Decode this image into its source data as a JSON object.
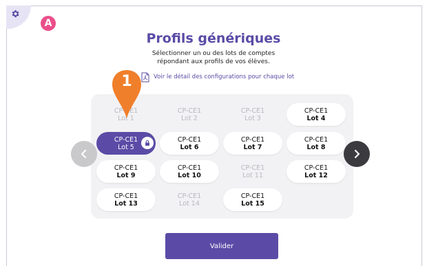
{
  "badge": "A",
  "title": "Profils génériques",
  "subtitle": [
    "Sélectionner un ou des lots de comptes",
    "répondant aux profils de vos élèves."
  ],
  "detail_link": "Voir le détail des configurations pour chaque lot",
  "marker_number": "1",
  "lots": [
    {
      "line1": "CP-CE1",
      "line2": "Lot 1",
      "state": "disabled"
    },
    {
      "line1": "CP-CE1",
      "line2": "Lot 2",
      "state": "disabled"
    },
    {
      "line1": "CP-CE1",
      "line2": "Lot 3",
      "state": "disabled"
    },
    {
      "line1": "CP-CE1",
      "line2": "Lot 4",
      "state": "available"
    },
    {
      "line1": "CP-CE1",
      "line2": "Lot 5",
      "state": "selected"
    },
    {
      "line1": "CP-CE1",
      "line2": "Lot 6",
      "state": "available"
    },
    {
      "line1": "CP-CE1",
      "line2": "Lot 7",
      "state": "available"
    },
    {
      "line1": "CP-CE1",
      "line2": "Lot 8",
      "state": "available"
    },
    {
      "line1": "CP-CE1",
      "line2": "Lot 9",
      "state": "available"
    },
    {
      "line1": "CP-CE1",
      "line2": "Lot 10",
      "state": "available"
    },
    {
      "line1": "CP-CE1",
      "line2": "Lot 11",
      "state": "disabled"
    },
    {
      "line1": "CP-CE1",
      "line2": "Lot 12",
      "state": "available"
    },
    {
      "line1": "CP-CE1",
      "line2": "Lot 13",
      "state": "available"
    },
    {
      "line1": "CP-CE1",
      "line2": "Lot 14",
      "state": "disabled"
    },
    {
      "line1": "CP-CE1",
      "line2": "Lot 15",
      "state": "available"
    }
  ],
  "validate_label": "Valider",
  "colors": {
    "accent": "#5b4ba6",
    "badge": "#ea4f8a",
    "marker": "#f07f2b"
  }
}
